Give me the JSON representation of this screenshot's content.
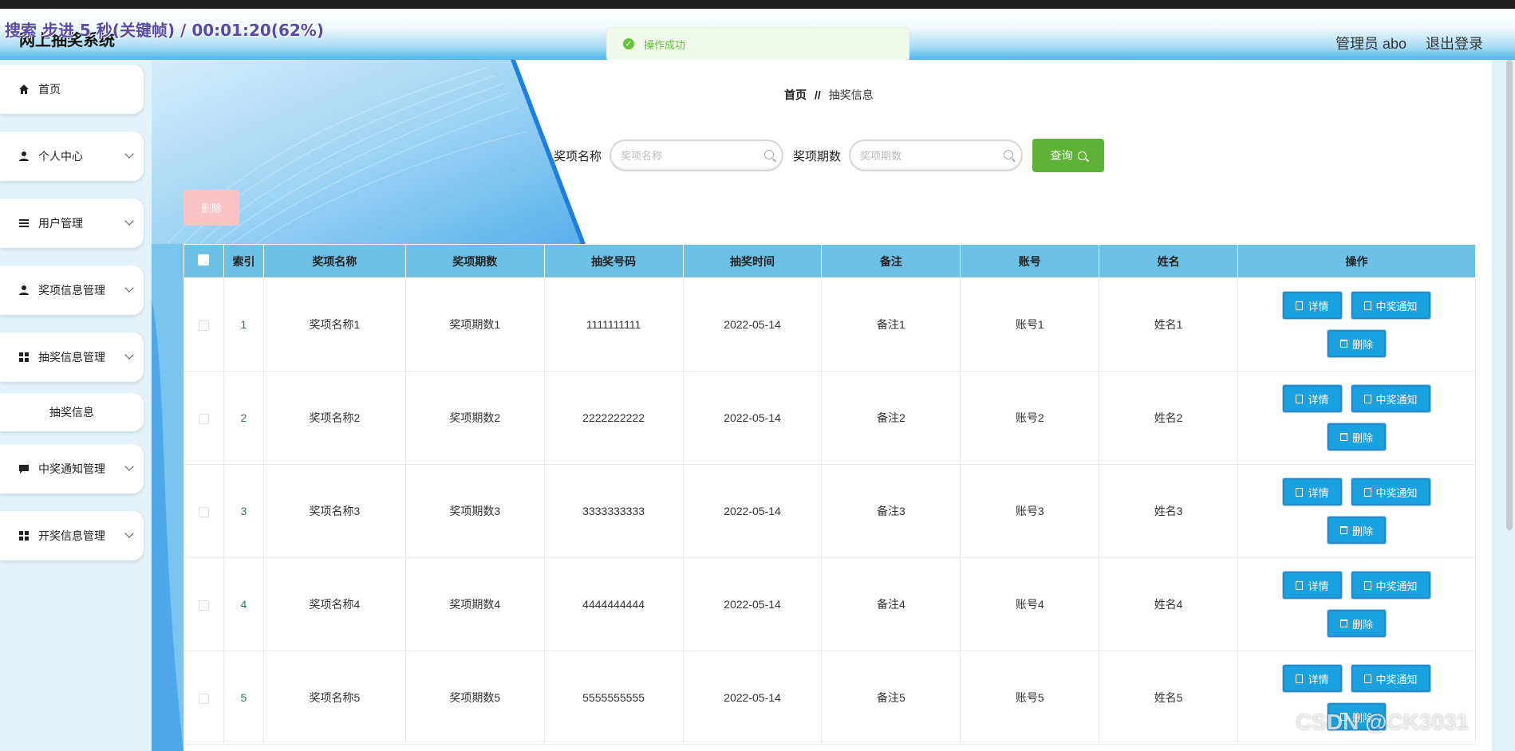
{
  "overlay": {
    "text": "搜索 步进 5 秒(关键帧) / 00:01:20(62%)"
  },
  "header": {
    "title": "网上抽奖系统",
    "user_label": "管理员 abo",
    "logout_label": "退出登录"
  },
  "toast": {
    "text": "操作成功",
    "color": "#67c23a"
  },
  "sidebar": {
    "items": [
      {
        "label": "首页",
        "icon": "home-icon"
      },
      {
        "label": "个人中心",
        "icon": "user-icon"
      },
      {
        "label": "用户管理",
        "icon": "list-icon"
      },
      {
        "label": "奖项信息管理",
        "icon": "user-icon"
      },
      {
        "label": "抽奖信息管理",
        "icon": "grid-icon"
      },
      {
        "label": "抽奖信息",
        "icon": ""
      },
      {
        "label": "中奖通知管理",
        "icon": "message-icon"
      },
      {
        "label": "开奖信息管理",
        "icon": "grid-icon"
      }
    ]
  },
  "breadcrumb": {
    "home": "首页",
    "separator": "//",
    "current": "抽奖信息"
  },
  "search": {
    "name_label": "奖项名称",
    "name_placeholder": "奖项名称",
    "period_label": "奖项期数",
    "period_placeholder": "奖项期数",
    "query_label": "查询"
  },
  "delete_button": "删除",
  "table": {
    "headers": [
      "索引",
      "奖项名称",
      "奖项期数",
      "抽奖号码",
      "抽奖时间",
      "备注",
      "账号",
      "姓名",
      "操作"
    ],
    "rows": [
      [
        "1",
        "奖项名称1",
        "奖项期数1",
        "1111111111",
        "2022-05-14",
        "备注1",
        "账号1",
        "姓名1"
      ],
      [
        "2",
        "奖项名称2",
        "奖项期数2",
        "2222222222",
        "2022-05-14",
        "备注2",
        "账号2",
        "姓名2"
      ],
      [
        "3",
        "奖项名称3",
        "奖项期数3",
        "3333333333",
        "2022-05-14",
        "备注3",
        "账号3",
        "姓名3"
      ],
      [
        "4",
        "奖项名称4",
        "奖项期数4",
        "4444444444",
        "2022-05-14",
        "备注4",
        "账号4",
        "姓名4"
      ],
      [
        "5",
        "奖项名称5",
        "奖项期数5",
        "5555555555",
        "2022-05-14",
        "备注5",
        "账号5",
        "姓名5"
      ]
    ],
    "actions": {
      "detail": "详情",
      "notify": "中奖通知",
      "delete": "删除"
    }
  },
  "watermark": "CSDN @CK3031",
  "colors": {
    "header_accent": "#4fb6ec",
    "table_header": "#6dc0e6",
    "query_button": "#5eb337",
    "action_button": "#1aa1e0",
    "delete_disabled": "#fbc4c4"
  }
}
